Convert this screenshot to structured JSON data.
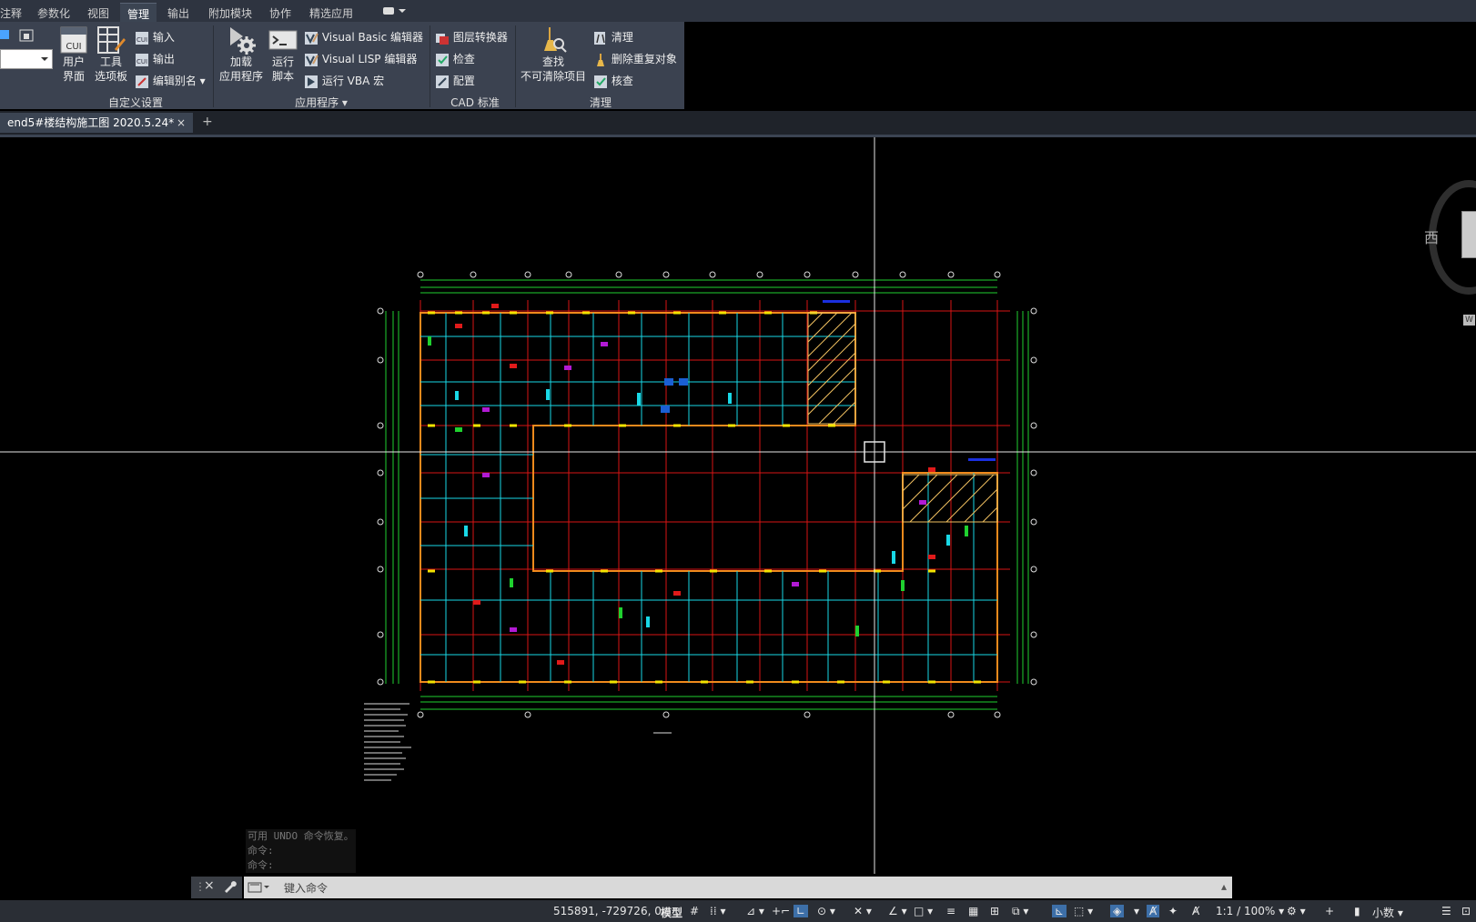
{
  "menu": {
    "tabs": [
      "注释",
      "参数化",
      "视图",
      "管理",
      "输出",
      "附加模块",
      "协作",
      "精选应用"
    ],
    "active": "管理"
  },
  "ribbon": {
    "customize": {
      "user_interface": [
        "用户",
        "界面"
      ],
      "tool_palettes": [
        "工具",
        "选项板"
      ],
      "import": "输入",
      "export": "输出",
      "edit_aliases": "编辑别名",
      "title": "自定义设置"
    },
    "apps": {
      "load_app": [
        "加载",
        "应用程序"
      ],
      "run_script": [
        "运行",
        "脚本"
      ],
      "vb_editor": "Visual Basic 编辑器",
      "lisp_editor": "Visual LISP 编辑器",
      "run_vba": "运行 VBA 宏",
      "title": "应用程序"
    },
    "cad_standards": {
      "layer_translator": "图层转换器",
      "check": "检查",
      "configure": "配置",
      "title": "CAD 标准"
    },
    "cleanup": {
      "find": [
        "查找",
        "不可清除项目"
      ],
      "purge": "清理",
      "overkill": "删除重复对象",
      "audit": "核查",
      "title": "清理"
    }
  },
  "document": {
    "tab_title": "end5#楼结构施工图 2020.5.24*",
    "new_tab": "+"
  },
  "viewcube": {
    "face": "西",
    "wcs": "W"
  },
  "command": {
    "history": [
      "可用 UNDO 命令恢复。",
      "命令:",
      "命令:"
    ],
    "placeholder": "键入命令"
  },
  "status": {
    "coords": "515891, -729726, 0",
    "model": "模型",
    "scale": "1:1 / 100%",
    "units": "小数"
  },
  "colors": {
    "ribbon_bg": "#3b4250",
    "grid_red": "#d81414",
    "grid_green": "#1fd12f",
    "beam_orange": "#f08a1c",
    "beam_cyan": "#19d8e6"
  }
}
